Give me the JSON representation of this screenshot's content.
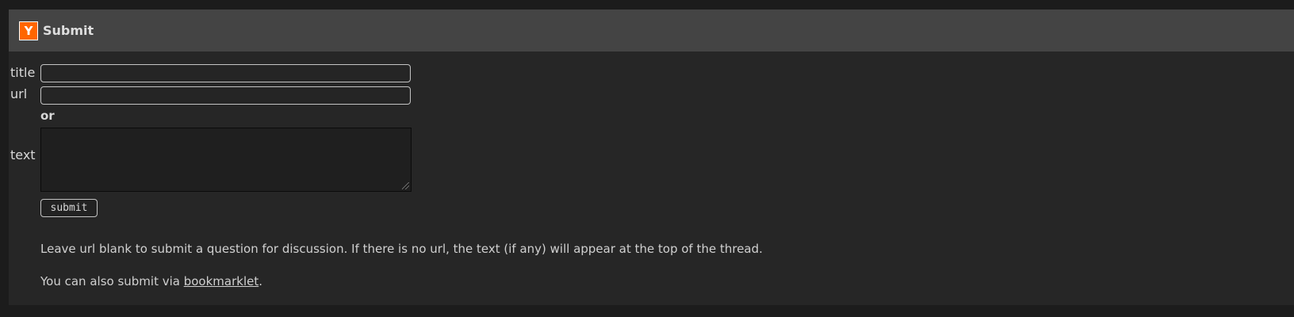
{
  "header": {
    "logo_letter": "Y",
    "title": "Submit"
  },
  "form": {
    "title_label": "title",
    "title_value": "",
    "url_label": "url",
    "url_value": "",
    "or_label": "or",
    "text_label": "text",
    "text_value": "",
    "submit_label": "submit"
  },
  "notes": {
    "blank_url_note": "Leave url blank to submit a question for discussion. If there is no url, the text (if any) will appear at the top of the thread.",
    "bookmarklet_prefix": "You can also submit via ",
    "bookmarklet_link": "bookmarklet",
    "bookmarklet_suffix": "."
  },
  "colors": {
    "accent": "#ff6600",
    "header_bg": "#444444",
    "page_bg": "#262626"
  }
}
